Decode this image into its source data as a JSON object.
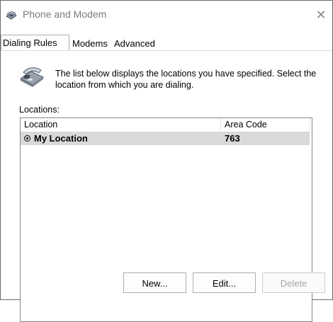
{
  "window": {
    "title": "Phone and Modem",
    "close_glyph": "✕"
  },
  "tabs": [
    {
      "label": "Dialing Rules",
      "active": true
    },
    {
      "label": "Modems",
      "active": false
    },
    {
      "label": "Advanced",
      "active": false
    }
  ],
  "panel": {
    "description": "The list below displays the locations you have specified. Select the location from which you are dialing.",
    "locations_label": "Locations:",
    "columns": [
      "Location",
      "Area Code"
    ],
    "rows": [
      {
        "location": "My Location",
        "area_code": "763",
        "selected": true
      }
    ]
  },
  "buttons": {
    "new": "New...",
    "edit": "Edit...",
    "delete": "Delete"
  },
  "icons": {
    "title": "phone-modem-icon",
    "panel": "telephone-icon",
    "row": "radio-selected-icon"
  },
  "colors": {
    "selection": "#d9d9d9",
    "disabled_text": "#a8a8a8"
  }
}
